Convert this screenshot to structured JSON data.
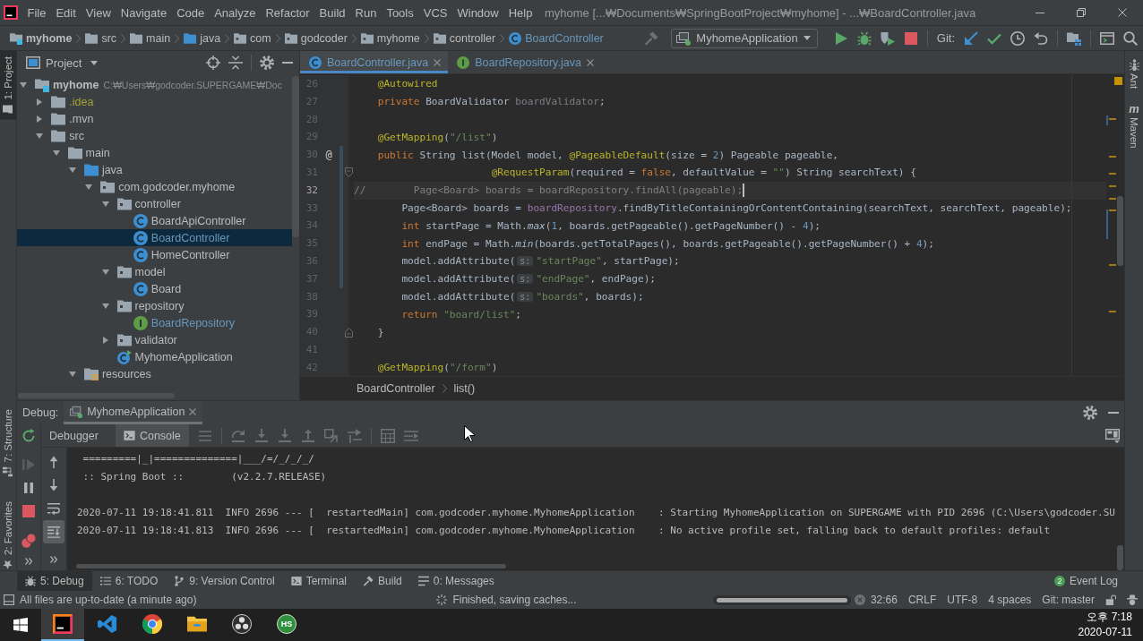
{
  "title_bar": {
    "menus": [
      "File",
      "Edit",
      "View",
      "Navigate",
      "Code",
      "Analyze",
      "Refactor",
      "Build",
      "Run",
      "Tools",
      "VCS",
      "Window",
      "Help"
    ],
    "title": "myhome [...₩Documents₩SpringBootProject₩myhome] - ...₩BoardController.java"
  },
  "navigation_bar": {
    "breadcrumbs": [
      {
        "label": "myhome",
        "kind": "module",
        "modified": false
      },
      {
        "label": "src",
        "kind": "folder",
        "modified": false
      },
      {
        "label": "main",
        "kind": "folder",
        "modified": false
      },
      {
        "label": "java",
        "kind": "source",
        "modified": false
      },
      {
        "label": "com",
        "kind": "package",
        "modified": false
      },
      {
        "label": "godcoder",
        "kind": "package",
        "modified": false
      },
      {
        "label": "myhome",
        "kind": "package",
        "modified": false
      },
      {
        "label": "controller",
        "kind": "package",
        "modified": false
      },
      {
        "label": "BoardController",
        "kind": "class",
        "modified": true
      }
    ],
    "run_configuration": "MyhomeApplication",
    "git_label": "Git:"
  },
  "left_stripe": {
    "top_tabs": [
      {
        "label": "1: Project",
        "kind": "project",
        "selected": true
      }
    ],
    "bottom_tabs": [
      {
        "label": "7: Structure",
        "kind": "structure",
        "selected": false
      },
      {
        "label": "2: Favorites",
        "kind": "favorites",
        "selected": false
      }
    ]
  },
  "right_stripe": {
    "tabs": [
      {
        "label": "Ant",
        "kind": "ant"
      },
      {
        "label": "Maven",
        "kind": "maven",
        "glyph": "m"
      }
    ]
  },
  "project_panel": {
    "title": "Project",
    "tree": [
      {
        "label": "myhome",
        "kind": "module",
        "path": "C:₩Users₩godcoder.SUPERGAME₩Doc",
        "modified": false,
        "ignored": false,
        "expanded": true,
        "selected": false,
        "children": [
          {
            "label": ".idea",
            "kind": "folder",
            "modified": false,
            "ignored": true,
            "expanded": false,
            "selected": false
          },
          {
            "label": ".mvn",
            "kind": "folder",
            "modified": false,
            "ignored": false,
            "expanded": false,
            "selected": false
          },
          {
            "label": "src",
            "kind": "folder",
            "modified": false,
            "ignored": false,
            "expanded": true,
            "selected": false,
            "children": [
              {
                "label": "main",
                "kind": "folder",
                "modified": false,
                "ignored": false,
                "expanded": true,
                "selected": false,
                "children": [
                  {
                    "label": "java",
                    "kind": "source",
                    "modified": false,
                    "ignored": false,
                    "expanded": true,
                    "selected": false,
                    "children": [
                      {
                        "label": "com.godcoder.myhome",
                        "kind": "package",
                        "modified": false,
                        "ignored": false,
                        "expanded": true,
                        "selected": false,
                        "children": [
                          {
                            "label": "controller",
                            "kind": "package",
                            "modified": false,
                            "ignored": false,
                            "expanded": true,
                            "selected": false,
                            "children": [
                              {
                                "label": "BoardApiController",
                                "kind": "class",
                                "modified": false,
                                "ignored": false,
                                "selected": false
                              },
                              {
                                "label": "BoardController",
                                "kind": "class",
                                "modified": true,
                                "ignored": false,
                                "selected": true
                              },
                              {
                                "label": "HomeController",
                                "kind": "class",
                                "modified": false,
                                "ignored": false,
                                "selected": false
                              }
                            ]
                          },
                          {
                            "label": "model",
                            "kind": "package",
                            "modified": false,
                            "ignored": false,
                            "expanded": true,
                            "selected": false,
                            "children": [
                              {
                                "label": "Board",
                                "kind": "class",
                                "modified": false,
                                "ignored": false,
                                "selected": false
                              }
                            ]
                          },
                          {
                            "label": "repository",
                            "kind": "package",
                            "modified": false,
                            "ignored": false,
                            "expanded": true,
                            "selected": false,
                            "children": [
                              {
                                "label": "BoardRepository",
                                "kind": "interface",
                                "modified": true,
                                "ignored": false,
                                "selected": false
                              }
                            ]
                          },
                          {
                            "label": "validator",
                            "kind": "package",
                            "modified": false,
                            "ignored": false,
                            "expanded": false,
                            "selected": false
                          },
                          {
                            "label": "MyhomeApplication",
                            "kind": "application",
                            "modified": false,
                            "ignored": false,
                            "selected": false
                          }
                        ]
                      }
                    ]
                  },
                  {
                    "label": "resources",
                    "kind": "resources",
                    "modified": false,
                    "ignored": false,
                    "expanded": true,
                    "selected": false
                  }
                ]
              }
            ]
          }
        ]
      }
    ]
  },
  "editor": {
    "tabs": [
      {
        "label": "BoardController.java",
        "kind": "class",
        "modified": true,
        "selected": true
      },
      {
        "label": "BoardRepository.java",
        "kind": "interface",
        "modified": true,
        "selected": false
      }
    ],
    "lines": [
      {
        "number": "26",
        "kind": "plain",
        "tokens": [
          {
            "kind": "annotation",
            "text": "    @Autowired"
          }
        ],
        "current": false,
        "changed": false
      },
      {
        "number": "27",
        "kind": "plain",
        "tokens": [
          {
            "kind": "keyword",
            "text": "    private"
          },
          {
            "kind": "plain",
            "text": " BoardValidator "
          },
          {
            "kind": "unused",
            "text": "boardValidator"
          },
          {
            "kind": "plain",
            "text": ";"
          }
        ],
        "current": false,
        "changed": false
      },
      {
        "number": "28",
        "kind": "plain",
        "current": false,
        "changed": false
      },
      {
        "number": "29",
        "kind": "plain",
        "tokens": [
          {
            "kind": "annotation",
            "text": "    @GetMapping"
          },
          {
            "kind": "plain",
            "text": "("
          },
          {
            "kind": "string",
            "text": "\"/list\""
          },
          {
            "kind": "plain",
            "text": ")"
          }
        ],
        "current": false,
        "changed": false
      },
      {
        "number": "30",
        "kind": "plain",
        "gutter_mark": "@",
        "tokens": [
          {
            "kind": "keyword",
            "text": "    public"
          },
          {
            "kind": "plain",
            "text": " String list(Model model, "
          },
          {
            "kind": "annotation",
            "text": "@PageableDefault"
          },
          {
            "kind": "plain",
            "text": "(size = "
          },
          {
            "kind": "number",
            "text": "2"
          },
          {
            "kind": "plain",
            "text": ") Pageable pageable,"
          }
        ],
        "current": false,
        "changed": true
      },
      {
        "number": "31",
        "kind": "fold_start",
        "tokens": [
          {
            "kind": "annotation",
            "text": "                       @RequestParam"
          },
          {
            "kind": "plain",
            "text": "(required = "
          },
          {
            "kind": "keyword",
            "text": "false"
          },
          {
            "kind": "plain",
            "text": ", defaultValue = "
          },
          {
            "kind": "string",
            "text": "\"\""
          },
          {
            "kind": "plain",
            "text": ") String searchText) {"
          }
        ],
        "current": false,
        "changed": true
      },
      {
        "number": "32",
        "kind": "plain",
        "tokens": [
          {
            "kind": "comment",
            "text": "//        Page<Board> boards = boardRepository.findAll(pageable);"
          }
        ],
        "current": true,
        "changed": true
      },
      {
        "number": "33",
        "kind": "plain",
        "tokens": [
          {
            "kind": "plain",
            "text": "        Page<Board> boards = "
          },
          {
            "kind": "field",
            "text": "boardRepository"
          },
          {
            "kind": "plain",
            "text": ".findByTitleContainingOrContentContaining(searchText, searchText, pageable);"
          }
        ],
        "current": false,
        "changed": true
      },
      {
        "number": "34",
        "kind": "plain",
        "tokens": [
          {
            "kind": "keyword",
            "text": "        int"
          },
          {
            "kind": "plain",
            "text": " startPage = Math."
          },
          {
            "kind": "static",
            "text": "max"
          },
          {
            "kind": "plain",
            "text": "("
          },
          {
            "kind": "number",
            "text": "1"
          },
          {
            "kind": "plain",
            "text": ", boards.getPageable().getPageNumber() - "
          },
          {
            "kind": "number",
            "text": "4"
          },
          {
            "kind": "plain",
            "text": ");"
          }
        ],
        "current": false,
        "changed": true
      },
      {
        "number": "35",
        "kind": "plain",
        "tokens": [
          {
            "kind": "keyword",
            "text": "        int"
          },
          {
            "kind": "plain",
            "text": " endPage = Math."
          },
          {
            "kind": "static",
            "text": "min"
          },
          {
            "kind": "plain",
            "text": "(boards.getTotalPages(), boards.getPageable().getPageNumber() + "
          },
          {
            "kind": "number",
            "text": "4"
          },
          {
            "kind": "plain",
            "text": ");"
          }
        ],
        "current": false,
        "changed": true
      },
      {
        "number": "36",
        "kind": "plain",
        "tokens": [
          {
            "kind": "plain",
            "text": "        model.addAttribute("
          },
          {
            "kind": "hint",
            "text": "s:"
          },
          {
            "kind": "string",
            "text": "\"startPage\""
          },
          {
            "kind": "plain",
            "text": ", startPage);"
          }
        ],
        "current": false,
        "changed": true
      },
      {
        "number": "37",
        "kind": "plain",
        "tokens": [
          {
            "kind": "plain",
            "text": "        model.addAttribute("
          },
          {
            "kind": "hint",
            "text": "s:"
          },
          {
            "kind": "string",
            "text": "\"endPage\""
          },
          {
            "kind": "plain",
            "text": ", endPage);"
          }
        ],
        "current": false,
        "changed": true
      },
      {
        "number": "38",
        "kind": "plain",
        "tokens": [
          {
            "kind": "plain",
            "text": "        model.addAttribute("
          },
          {
            "kind": "hint",
            "text": "s:"
          },
          {
            "kind": "string",
            "text": "\"boards\""
          },
          {
            "kind": "plain",
            "text": ", boards);"
          }
        ],
        "current": false,
        "changed": false
      },
      {
        "number": "39",
        "kind": "plain",
        "tokens": [
          {
            "kind": "keyword",
            "text": "        return"
          },
          {
            "kind": "string",
            "text": " \"board/list\""
          },
          {
            "kind": "plain",
            "text": ";"
          }
        ],
        "current": false,
        "changed": false
      },
      {
        "number": "40",
        "kind": "fold_end",
        "tokens": [
          {
            "kind": "plain",
            "text": "    }"
          }
        ],
        "current": false,
        "changed": false
      },
      {
        "number": "41",
        "kind": "plain",
        "current": false,
        "changed": false
      },
      {
        "number": "42",
        "kind": "plain",
        "tokens": [
          {
            "kind": "annotation",
            "text": "    @GetMapping"
          },
          {
            "kind": "plain",
            "text": "("
          },
          {
            "kind": "string",
            "text": "\"/form\""
          },
          {
            "kind": "plain",
            "text": ")"
          }
        ],
        "current": false,
        "changed": false
      }
    ],
    "breadcrumbs": [
      "BoardController",
      "list()"
    ]
  },
  "debug_panel": {
    "label": "Debug:",
    "sessions": [
      {
        "label": "MyhomeApplication",
        "selected": true
      }
    ],
    "tabs": [
      {
        "label": "Debugger",
        "kind": "debugger",
        "selected": false
      },
      {
        "label": "Console",
        "kind": "console",
        "selected": true
      }
    ],
    "toggles": [
      {
        "kind": "soft_wrap",
        "on": false
      },
      {
        "kind": "scroll_to_end",
        "on": true
      }
    ],
    "banner": [
      " =========|_|==============|___/=/_/_/_/",
      " :: Spring Boot ::        (v2.2.7.RELEASE)"
    ],
    "log": [
      "2020-07-11 19:18:41.811  INFO 2696 --- [  restartedMain] com.godcoder.myhome.MyhomeApplication    : Starting MyhomeApplication on SUPERGAME with PID 2696 (C:\\Users\\godcoder.SU",
      "2020-07-11 19:18:41.813  INFO 2696 --- [  restartedMain] com.godcoder.myhome.MyhomeApplication    : No active profile set, falling back to default profiles: default"
    ]
  },
  "tool_window_bar": {
    "tools": [
      {
        "label": "5: Debug",
        "kind": "debug",
        "selected": true
      },
      {
        "label": "6: TODO",
        "kind": "todo",
        "selected": false
      },
      {
        "label": "9: Version Control",
        "kind": "vcs",
        "selected": false
      },
      {
        "label": "Terminal",
        "kind": "terminal",
        "selected": false
      },
      {
        "label": "Build",
        "kind": "build",
        "selected": false
      },
      {
        "label": "0: Messages",
        "kind": "messages",
        "selected": false
      }
    ],
    "event_log": {
      "label": "Event Log",
      "count": "2"
    }
  },
  "status_bar": {
    "message": "All files are up-to-date (a minute ago)",
    "task": "Finished, saving caches...",
    "progress": {
      "level": 1
    },
    "items": [
      "32:66",
      "CRLF",
      "UTF-8",
      "4 spaces",
      "Git: master"
    ]
  },
  "taskbar": {
    "apps": [
      {
        "kind": "intellij",
        "selected": true
      },
      {
        "kind": "vscode",
        "selected": false
      },
      {
        "kind": "chrome",
        "selected": false
      },
      {
        "kind": "explorer",
        "selected": false
      },
      {
        "kind": "obs",
        "selected": false
      },
      {
        "kind": "hs",
        "label": "HS",
        "selected": false
      }
    ],
    "time": "오후 7:18",
    "date": "2020-07-11"
  }
}
